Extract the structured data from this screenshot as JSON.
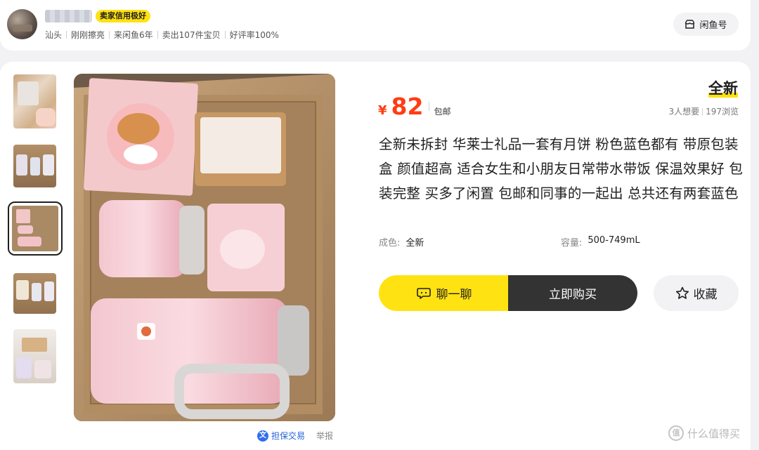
{
  "seller": {
    "badge": "卖家信用极好",
    "meta": [
      "汕头",
      "刚刚擦亮",
      "来闲鱼6年",
      "卖出107件宝贝",
      "好评率100%"
    ],
    "xianyu_button": "闲鱼号"
  },
  "gallery": {
    "thumb_count": 5,
    "active_index": 2
  },
  "photo_footer": {
    "guarantee": "担保交易",
    "guarantee_icon": "文",
    "report": "举报"
  },
  "product": {
    "condition": "全新",
    "currency": "¥",
    "price": "82",
    "shipping": "包邮",
    "wants": "3人想要",
    "views": "197浏览",
    "description": "全新未拆封 华莱士礼品一套有月饼 粉色蓝色都有 带原包装盒 颜值超高 适合女生和小朋友日常带水带饭 保温效果好 包装完整 买多了闲置 包邮和同事的一起出 总共还有两套蓝色",
    "attrs": {
      "condition_key": "成色:",
      "condition_val": "全新",
      "capacity_key": "容量:",
      "capacity_val": "500-749mL"
    }
  },
  "actions": {
    "chat": "聊一聊",
    "buy": "立即购买",
    "favorite": "收藏"
  },
  "watermark": {
    "logo": "值",
    "text": "什么值得买"
  },
  "colors": {
    "accent_yellow": "#ffe211",
    "price_red": "#ff3c13",
    "dark_button": "#333333"
  }
}
